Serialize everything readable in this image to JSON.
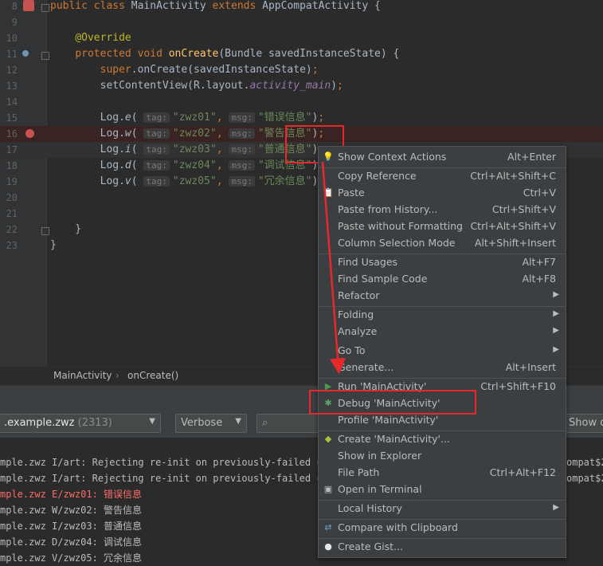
{
  "editor": {
    "lines": [
      {
        "num": "8",
        "parts": [
          [
            "kw",
            "public "
          ],
          [
            "kw",
            "class "
          ],
          [
            "",
            "MainActivity "
          ],
          [
            "kw",
            "extends "
          ],
          [
            "",
            "AppCompatActivity {"
          ]
        ]
      },
      {
        "num": "9",
        "parts": []
      },
      {
        "num": "10",
        "parts": [
          [
            "",
            "    "
          ],
          [
            "ann",
            "@Override"
          ]
        ]
      },
      {
        "num": "11",
        "parts": [
          [
            "",
            "    "
          ],
          [
            "kw",
            "protected "
          ],
          [
            "kw",
            "void "
          ],
          [
            "fn",
            "onCreate"
          ],
          [
            "",
            "(Bundle savedInstanceState) {"
          ]
        ]
      },
      {
        "num": "12",
        "parts": [
          [
            "",
            "        "
          ],
          [
            "kw",
            "super"
          ],
          [
            "",
            "."
          ],
          [
            "",
            "onCreate(savedInstanceState)"
          ],
          [
            "kw",
            ";"
          ]
        ]
      },
      {
        "num": "13",
        "parts": [
          [
            "",
            "        setContentView(R.layout."
          ],
          [
            "field",
            "activity_main"
          ],
          [
            "",
            ")"
          ],
          [
            "kw",
            ";"
          ]
        ]
      },
      {
        "num": "14",
        "parts": []
      },
      {
        "num": "15",
        "parts": [
          [
            "",
            "        Log."
          ],
          [
            "it",
            "e"
          ],
          [
            "",
            "( "
          ],
          [
            "hint",
            "tag:"
          ],
          [
            "str",
            "\"zwz01\""
          ],
          [
            "kw",
            ", "
          ],
          [
            "hint",
            "msg:"
          ],
          [
            "str",
            "\"错误信息\""
          ],
          [
            "",
            ")"
          ],
          [
            "kw",
            ";"
          ]
        ]
      },
      {
        "num": "16",
        "parts": [
          [
            "",
            "        Log."
          ],
          [
            "it",
            "w"
          ],
          [
            "",
            "( "
          ],
          [
            "hint",
            "tag:"
          ],
          [
            "str",
            "\"zwz02\""
          ],
          [
            "kw",
            ", "
          ],
          [
            "hint",
            "msg:"
          ],
          [
            "str",
            "\"警告信息\""
          ],
          [
            "",
            ")"
          ],
          [
            "kw",
            ";"
          ]
        ]
      },
      {
        "num": "17",
        "parts": [
          [
            "",
            "        Log."
          ],
          [
            "it",
            "i"
          ],
          [
            "",
            "( "
          ],
          [
            "hint",
            "tag:"
          ],
          [
            "str",
            "\"zwz03\""
          ],
          [
            "kw",
            ", "
          ],
          [
            "hint",
            "msg:"
          ],
          [
            "str",
            "\"普通信息\""
          ],
          [
            "",
            ")"
          ],
          [
            "kw",
            ";"
          ]
        ]
      },
      {
        "num": "18",
        "parts": [
          [
            "",
            "        Log."
          ],
          [
            "it",
            "d"
          ],
          [
            "",
            "( "
          ],
          [
            "hint",
            "tag:"
          ],
          [
            "str",
            "\"zwz04\""
          ],
          [
            "kw",
            ", "
          ],
          [
            "hint",
            "msg:"
          ],
          [
            "str",
            "\"调试信息\""
          ],
          [
            "",
            ")"
          ],
          [
            "kw",
            ";"
          ]
        ]
      },
      {
        "num": "19",
        "parts": [
          [
            "",
            "        Log."
          ],
          [
            "it",
            "v"
          ],
          [
            "",
            "( "
          ],
          [
            "hint",
            "tag:"
          ],
          [
            "str",
            "\"zwz05\""
          ],
          [
            "kw",
            ", "
          ],
          [
            "hint",
            "msg:"
          ],
          [
            "str",
            "\"冗余信息\""
          ],
          [
            "",
            ")"
          ],
          [
            "kw",
            ";"
          ]
        ]
      },
      {
        "num": "20",
        "parts": []
      },
      {
        "num": "21",
        "parts": []
      },
      {
        "num": "22",
        "parts": [
          [
            "",
            "    }"
          ]
        ]
      },
      {
        "num": "23",
        "parts": [
          [
            "",
            "}"
          ]
        ]
      }
    ]
  },
  "breadcrumb": {
    "class": "MainActivity",
    "sep": "›",
    "method": "onCreate()"
  },
  "logcat": {
    "process": ".example.zwz",
    "pid": "(2313)",
    "level": "Verbose",
    "search_icon": "search-icon",
    "show_only": "Show on",
    "lines": [
      {
        "text": "mple.zwz I/art: Rejecting re-init on previously-failed cl",
        "tail": "ompat$2",
        "color": "#bbbbbb"
      },
      {
        "text": "mple.zwz I/art: Rejecting re-init on previously-failed cl",
        "tail": "ompat$2",
        "color": "#bbbbbb"
      },
      {
        "text": "mple.zwz E/zwz01: 错误信息",
        "tail": "",
        "color": "#ff6b68"
      },
      {
        "text": "mple.zwz W/zwz02: 警告信息",
        "tail": "",
        "color": "#bbbbbb"
      },
      {
        "text": "mple.zwz I/zwz03: 普通信息",
        "tail": "",
        "color": "#bbbbbb"
      },
      {
        "text": "mple.zwz D/zwz04: 调试信息",
        "tail": "",
        "color": "#bbbbbb"
      },
      {
        "text": "mple.zwz V/zwz05: 冗余信息",
        "tail": "",
        "color": "#bbbbbb"
      }
    ]
  },
  "menu": {
    "items": [
      {
        "label": "Show Context Actions",
        "shortcut": "Alt+Enter",
        "icon": "lightbulb-icon"
      },
      {
        "label": "Copy Reference",
        "shortcut": "Ctrl+Alt+Shift+C"
      },
      {
        "label": "Paste",
        "shortcut": "Ctrl+V",
        "icon": "clipboard-icon"
      },
      {
        "label": "Paste from History...",
        "shortcut": "Ctrl+Shift+V"
      },
      {
        "label": "Paste without Formatting",
        "shortcut": "Ctrl+Alt+Shift+V"
      },
      {
        "label": "Column Selection Mode",
        "shortcut": "Alt+Shift+Insert"
      },
      {
        "label": "Find Usages",
        "shortcut": "Alt+F7"
      },
      {
        "label": "Find Sample Code",
        "shortcut": "Alt+F8"
      },
      {
        "label": "Refactor",
        "shortcut": ""
      },
      {
        "label": "Folding",
        "shortcut": ""
      },
      {
        "label": "Analyze",
        "shortcut": ""
      },
      {
        "label": "Go To",
        "shortcut": ""
      },
      {
        "label": "Generate...",
        "shortcut": "Alt+Insert"
      },
      {
        "label": "Run 'MainActivity'",
        "shortcut": "Ctrl+Shift+F10",
        "icon": "run-icon"
      },
      {
        "label": "Debug 'MainActivity'",
        "shortcut": "",
        "icon": "debug-icon"
      },
      {
        "label": "Profile 'MainActivity'",
        "shortcut": ""
      },
      {
        "label": "Create 'MainActivity'...",
        "shortcut": "",
        "icon": "android-icon"
      },
      {
        "label": "Show in Explorer",
        "shortcut": ""
      },
      {
        "label": "File Path",
        "shortcut": "Ctrl+Alt+F12"
      },
      {
        "label": "Open in Terminal",
        "shortcut": "",
        "icon": "terminal-icon"
      },
      {
        "label": "Local History",
        "shortcut": ""
      },
      {
        "label": "Compare with Clipboard",
        "shortcut": "",
        "icon": "compare-icon"
      },
      {
        "label": "Create Gist...",
        "shortcut": "",
        "icon": "github-icon"
      }
    ]
  },
  "colors": {
    "highlight_box": "#e8282b",
    "breakpoint": "#c75450",
    "run": "#499c54",
    "debug": "#59a869"
  }
}
